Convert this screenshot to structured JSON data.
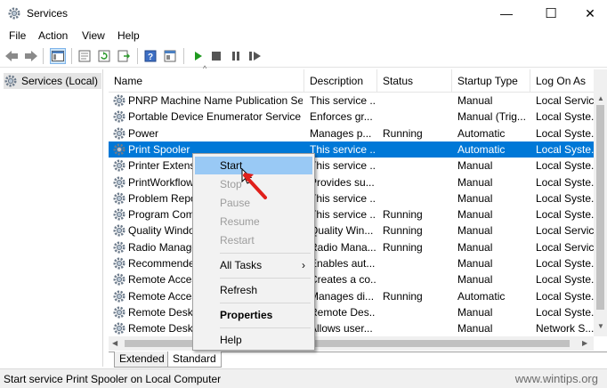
{
  "window": {
    "title": "Services",
    "minimize": "—",
    "maximize": "☐",
    "close": "✕"
  },
  "menu": [
    "File",
    "Action",
    "View",
    "Help"
  ],
  "toolbar": [
    "back-icon",
    "forward-icon",
    "show-hide-tree-icon",
    "properties-icon",
    "refresh-icon",
    "export-list-icon",
    "help-icon",
    "console-icon",
    "start-service-icon",
    "stop-service-icon",
    "pause-service-icon",
    "restart-service-icon"
  ],
  "tree": {
    "root": "Services (Local)"
  },
  "columns": {
    "name": "Name",
    "description": "Description",
    "status": "Status",
    "startup": "Startup Type",
    "logon": "Log On As"
  },
  "rows": [
    {
      "name": "PNRP Machine Name Publication Ser...",
      "description": "This service ...",
      "status": "",
      "startup": "Manual",
      "logon": "Local Service"
    },
    {
      "name": "Portable Device Enumerator Service",
      "description": "Enforces gr...",
      "status": "",
      "startup": "Manual (Trig...",
      "logon": "Local Syste..."
    },
    {
      "name": "Power",
      "description": "Manages p...",
      "status": "Running",
      "startup": "Automatic",
      "logon": "Local Syste..."
    },
    {
      "name": "Print Spooler",
      "description": "This service ...",
      "status": "",
      "startup": "Automatic",
      "logon": "Local Syste..."
    },
    {
      "name": "Printer Extensions and Notifications",
      "description": "This service ...",
      "status": "",
      "startup": "Manual",
      "logon": "Local Syste..."
    },
    {
      "name": "PrintWorkflow",
      "description": "Provides su...",
      "status": "",
      "startup": "Manual",
      "logon": "Local Syste..."
    },
    {
      "name": "Problem Reports Control Panel Support",
      "description": "This service ...",
      "status": "",
      "startup": "Manual",
      "logon": "Local Syste..."
    },
    {
      "name": "Program Compatibility Assistant Service",
      "description": "This service ...",
      "status": "Running",
      "startup": "Manual",
      "logon": "Local Syste..."
    },
    {
      "name": "Quality Windows Audio Video Experience",
      "description": "Quality Win...",
      "status": "Running",
      "startup": "Manual",
      "logon": "Local Service"
    },
    {
      "name": "Radio Management Service",
      "description": "Radio Mana...",
      "status": "Running",
      "startup": "Manual",
      "logon": "Local Service"
    },
    {
      "name": "Recommended Troubleshooting Service",
      "description": "Enables aut...",
      "status": "",
      "startup": "Manual",
      "logon": "Local Syste..."
    },
    {
      "name": "Remote Access Auto Connection Manager",
      "description": "Creates a co...",
      "status": "",
      "startup": "Manual",
      "logon": "Local Syste..."
    },
    {
      "name": "Remote Access Connection Manager",
      "description": "Manages di...",
      "status": "Running",
      "startup": "Automatic",
      "logon": "Local Syste..."
    },
    {
      "name": "Remote Desktop Configuration",
      "description": "Remote Des...",
      "status": "",
      "startup": "Manual",
      "logon": "Local Syste..."
    },
    {
      "name": "Remote Desktop Services",
      "description": "Allows user...",
      "status": "",
      "startup": "Manual",
      "logon": "Network S..."
    }
  ],
  "selected_row_index": 3,
  "context_menu": [
    {
      "label": "Start",
      "state": "highlighted"
    },
    {
      "label": "Stop",
      "state": "disabled"
    },
    {
      "label": "Pause",
      "state": "disabled"
    },
    {
      "label": "Resume",
      "state": "disabled"
    },
    {
      "label": "Restart",
      "state": "disabled"
    },
    {
      "label": "All Tasks",
      "state": "submenu",
      "arrow": "›"
    },
    {
      "label": "Refresh",
      "state": "normal"
    },
    {
      "label": "Properties",
      "state": "default"
    },
    {
      "label": "Help",
      "state": "normal"
    }
  ],
  "tabs": [
    {
      "label": "Extended",
      "active": false
    },
    {
      "label": "Standard",
      "active": true
    }
  ],
  "status_bar": "Start service Print Spooler on Local Computer",
  "watermark": "www.wintips.org",
  "colors": {
    "selection": "#0078d7",
    "menu_highlight": "#99c9f5",
    "cursor_arrow": "#e0201b"
  }
}
